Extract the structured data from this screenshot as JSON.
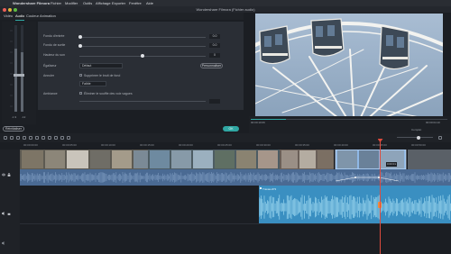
{
  "menu": {
    "app_name": "Wondershare Filmora",
    "items": [
      "Fichier",
      "Modifier",
      "Outils",
      "Affichage",
      "Exporter",
      "Fenêtre",
      "Aide"
    ]
  },
  "window": {
    "title": "Wondershare Filmora (Fichier audio)"
  },
  "tabs": [
    {
      "label": "Vidéo",
      "active": false
    },
    {
      "label": "Audio",
      "active": true
    },
    {
      "label": "Couleur",
      "active": false
    },
    {
      "label": "Animation",
      "active": false
    }
  ],
  "meter": {
    "readout": "-1.9",
    "value_b": "-12"
  },
  "audio": {
    "fade_in_label": "Fondu d'entrée",
    "fade_in_value": "0.0",
    "fade_out_label": "Fondu de sortie",
    "fade_out_value": "0.0",
    "pitch_label": "Hauteur du son",
    "pitch_value": "0",
    "equalizer_label": "Égaliseur",
    "equalizer_value": "Défaut",
    "customize_button": "Personnaliser",
    "denoise_label": "Annuler",
    "denoise_option": "Supprimer le bruit de fond",
    "denoise_level": "Faible",
    "ambient_label": "Ambiance",
    "ambient_option": "Éliminer le souffle des voix vagues"
  },
  "bottom_left_button": "Réinitialiser",
  "ok_button": "OK",
  "preview": {
    "time_left": "00:00:10:06",
    "time_right": "00:00:04:10",
    "progress_fraction": 0.18,
    "quality_label": "Complet"
  },
  "timeline": {
    "ruler_ticks": [
      "00:00:00:00",
      "00:00:05:00",
      "00:00:10:00",
      "00:00:15:00",
      "00:00:20:00",
      "00:00:25:00",
      "00:00:30:00",
      "00:00:35:00",
      "00:00:40:00",
      "00:00:45:00",
      "00:00:50:00"
    ],
    "music_clip_label": "Travaux/P3",
    "clip_tooltip": "0:00:01"
  },
  "colors": {
    "accent": "#30a7a3",
    "audio_track": "#3a8fc1",
    "video_audio": "#4a6a93",
    "playhead": "#e04b3d",
    "selection": "#8fb8e6"
  },
  "icons": [
    "play-icon",
    "stop-icon",
    "volume-icon",
    "scissors-icon",
    "undo-icon",
    "redo-icon",
    "delete-icon",
    "lock-icon",
    "eye-icon",
    "speaker-icon",
    "music-icon"
  ]
}
